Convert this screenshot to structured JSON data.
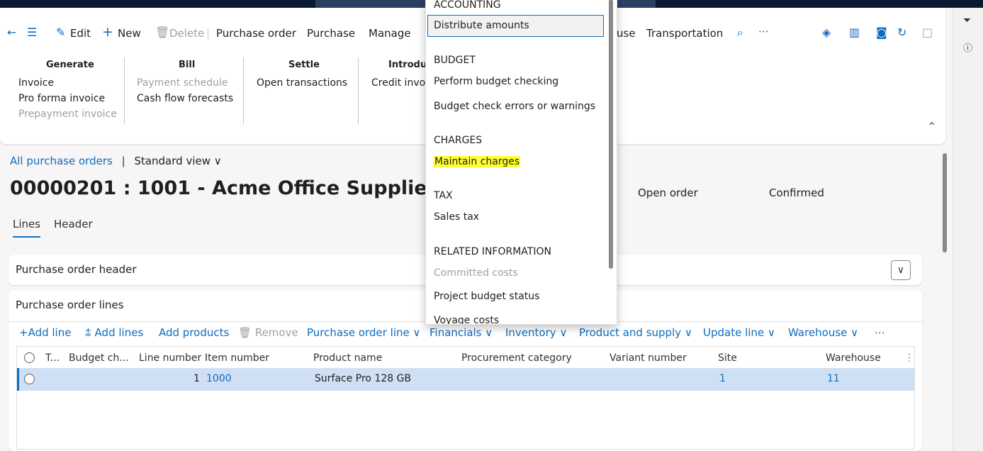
{
  "toolbar": {
    "edit": "Edit",
    "new": "New",
    "delete": "Delete",
    "purchase_order": "Purchase order",
    "purchase": "Purchase",
    "manage": "Manage",
    "warehouse_partial": "use",
    "transportation": "Transportation",
    "more": "⋯"
  },
  "ribbon": {
    "generate": {
      "title": "Generate",
      "items": [
        "Invoice",
        "Pro forma invoice",
        "Prepayment invoice"
      ]
    },
    "bill": {
      "title": "Bill",
      "items": [
        "Payment schedule",
        "Cash flow forecasts"
      ]
    },
    "settle": {
      "title": "Settle",
      "items": [
        "Open transactions"
      ]
    },
    "introduce": {
      "title": "Introduc",
      "items": [
        "Credit invo"
      ]
    }
  },
  "breadcrumb": {
    "link": "All purchase orders",
    "separator": "|",
    "view": "Standard view"
  },
  "page_title": "00000201 : 1001 - Acme Office Supplies",
  "status": {
    "order_state": "Open order",
    "approval": "Confirmed"
  },
  "tabs": [
    "Lines",
    "Header"
  ],
  "header_card": {
    "title": "Purchase order header"
  },
  "lines_card": {
    "title": "Purchase order lines"
  },
  "line_actions": {
    "add_line": "Add line",
    "add_lines": "Add lines",
    "add_products": "Add products",
    "remove": "Remove",
    "po_line": "Purchase order line",
    "financials": "Financials",
    "inventory": "Inventory",
    "product_supply": "Product and supply",
    "update_line": "Update line",
    "warehouse": "Warehouse",
    "more": "⋯"
  },
  "grid": {
    "headers": [
      "T...",
      "Budget ch...",
      "Line number",
      "Item number",
      "Product name",
      "Procurement category",
      "Variant number",
      "Site",
      "Warehouse"
    ],
    "rows": [
      {
        "line_number": "1",
        "item_number": "1000",
        "product_name": "Surface Pro 128 GB",
        "site": "1",
        "warehouse": "11"
      }
    ]
  },
  "menu": {
    "accounting": "ACCOUNTING",
    "distribute": "Distribute amounts",
    "budget": "BUDGET",
    "perform_budget": "Perform budget checking",
    "budget_errors": "Budget check errors or warnings",
    "charges": "CHARGES",
    "maintain_charges": "Maintain charges",
    "tax": "TAX",
    "sales_tax": "Sales tax",
    "related": "RELATED INFORMATION",
    "committed": "Committed costs",
    "project_budget": "Project budget status",
    "voyage": "Voyage costs"
  },
  "colors": {
    "accent": "#0f6cbd",
    "highlight": "#ffff33",
    "selected_row": "#cfe0f5"
  }
}
